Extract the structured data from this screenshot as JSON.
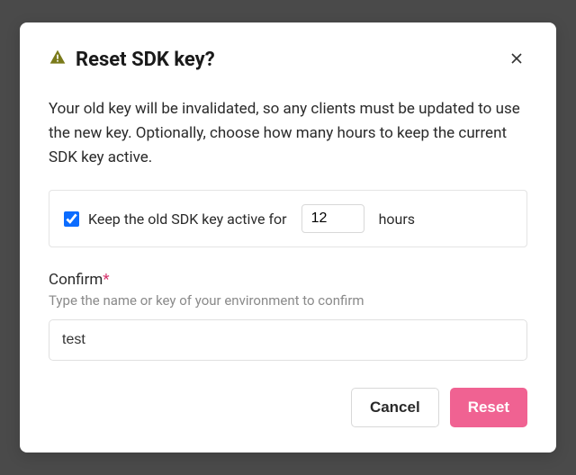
{
  "modal": {
    "title": "Reset SDK key?",
    "description": "Your old key will be invalidated, so any clients must be updated to use the new key. Optionally, choose how many hours to keep the current SDK key active.",
    "keep_active": {
      "checked": true,
      "label_before": "Keep the old SDK key active for",
      "hours_value": "12",
      "label_after": "hours"
    },
    "confirm": {
      "label": "Confirm",
      "required_mark": "*",
      "hint": "Type the name or key of your environment to confirm",
      "value": "test"
    },
    "buttons": {
      "cancel": "Cancel",
      "reset": "Reset"
    }
  },
  "colors": {
    "warning_icon": "#7a7a1a",
    "primary_action": "#f06292",
    "checkbox_accent": "#0b6cff"
  }
}
